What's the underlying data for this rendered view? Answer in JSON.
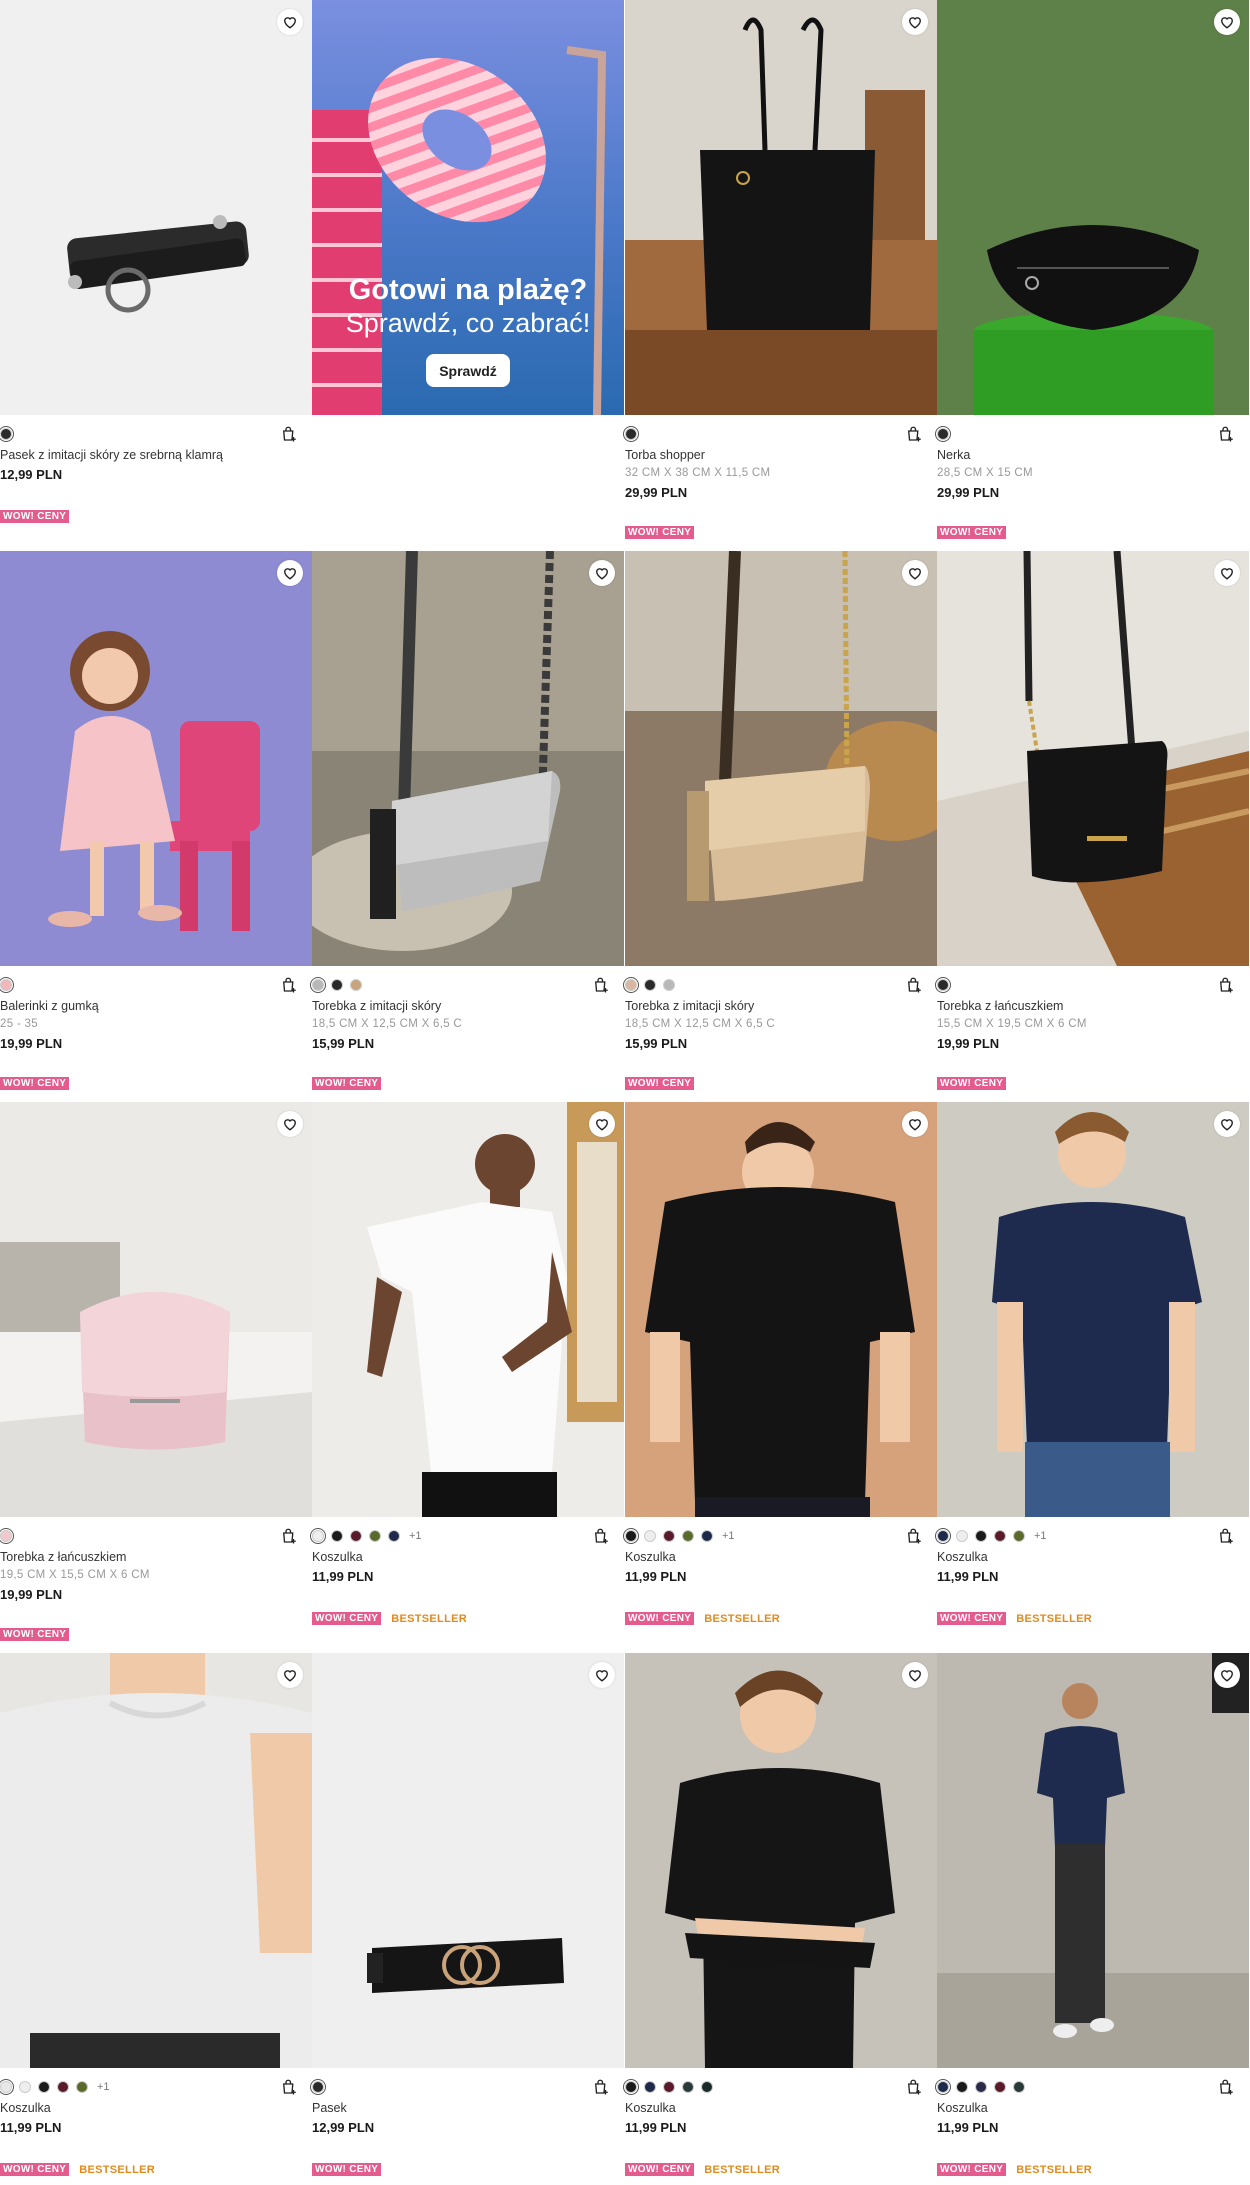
{
  "colors": {
    "wow": "#e45c8e",
    "bestseller": "#e28a1e"
  },
  "promo": {
    "title": "Gotowi na plażę?",
    "subtitle": "Sprawdź, co zabrać!",
    "button": "Sprawdź"
  },
  "products": [
    {
      "name": "Pasek z imitacji skóry ze srebrną klamrą",
      "dims": "",
      "price": "12,99 PLN",
      "badges": [
        "WOW! CENY"
      ],
      "swatches": [
        "#2a2a2a"
      ],
      "more": ""
    },
    {
      "name": "Torba shopper",
      "dims": "32 CM X 38 CM X 11,5 CM",
      "price": "29,99 PLN",
      "badges": [
        "WOW! CENY"
      ],
      "swatches": [
        "#2a2a2a"
      ],
      "more": ""
    },
    {
      "name": "Nerka",
      "dims": "28,5 CM X 15 CM",
      "price": "29,99 PLN",
      "badges": [
        "WOW! CENY"
      ],
      "swatches": [
        "#2a2a2a"
      ],
      "more": ""
    },
    {
      "name": "Balerinki z gumką",
      "dims": "25 - 35",
      "price": "19,99 PLN",
      "badges": [
        "WOW! CENY"
      ],
      "swatches": [
        "#f0b8b8"
      ],
      "more": ""
    },
    {
      "name": "Torebka z imitacji skóry",
      "dims": "18,5 CM X 12,5 CM X 6,5 C",
      "price": "15,99 PLN",
      "badges": [
        "WOW! CENY"
      ],
      "swatches": [
        "#b8b8b8",
        "#2a2a2a",
        "#c8a47c"
      ],
      "more": ""
    },
    {
      "name": "Torebka z imitacji skóry",
      "dims": "18,5 CM X 12,5 CM X 6,5 C",
      "price": "15,99 PLN",
      "badges": [
        "WOW! CENY"
      ],
      "swatches": [
        "#d8b8a0",
        "#2a2a2a",
        "#b8b8b8"
      ],
      "more": ""
    },
    {
      "name": "Torebka z łańcuszkiem",
      "dims": "15,5 CM X 19,5 CM X 6 CM",
      "price": "19,99 PLN",
      "badges": [
        "WOW! CENY"
      ],
      "swatches": [
        "#2a2a2a"
      ],
      "more": ""
    },
    {
      "name": "Torebka z łańcuszkiem",
      "dims": "19,5 CM X 15,5 CM X 6 CM",
      "price": "19,99 PLN",
      "badges": [
        "WOW! CENY"
      ],
      "swatches": [
        "#f2c8cc"
      ],
      "more": ""
    },
    {
      "name": "Koszulka",
      "dims": "",
      "price": "11,99 PLN",
      "badges": [
        "WOW! CENY",
        "BESTSELLER"
      ],
      "swatches": [
        "#eeeeee",
        "#1a1a1a",
        "#5a1a2a",
        "#5a6a2a",
        "#1e2a4a"
      ],
      "more": "+1"
    },
    {
      "name": "Koszulka",
      "dims": "",
      "price": "11,99 PLN",
      "badges": [
        "WOW! CENY",
        "BESTSELLER"
      ],
      "swatches": [
        "#1a1a1a",
        "#eeeeee",
        "#5a1a2a",
        "#5a6a2a",
        "#1e2a4a"
      ],
      "more": "+1"
    },
    {
      "name": "Koszulka",
      "dims": "",
      "price": "11,99 PLN",
      "badges": [
        "WOW! CENY",
        "BESTSELLER"
      ],
      "swatches": [
        "#1e2a4a",
        "#eeeeee",
        "#1a1a1a",
        "#5a1a2a",
        "#5a6a2a"
      ],
      "more": "+1"
    },
    {
      "name": "Koszulka",
      "dims": "",
      "price": "11,99 PLN",
      "badges": [
        "WOW! CENY",
        "BESTSELLER"
      ],
      "swatches": [
        "#e8e8e8",
        "#eeeeee",
        "#1a1a1a",
        "#5a1a2a",
        "#5a6a2a"
      ],
      "more": "+1"
    },
    {
      "name": "Pasek",
      "dims": "",
      "price": "12,99 PLN",
      "badges": [
        "WOW! CENY"
      ],
      "swatches": [
        "#2a2a2a"
      ],
      "more": ""
    },
    {
      "name": "Koszulka",
      "dims": "",
      "price": "11,99 PLN",
      "badges": [
        "WOW! CENY",
        "BESTSELLER"
      ],
      "swatches": [
        "#1a1a1a",
        "#1e2a4a",
        "#5a1a2a",
        "#2a3a3a",
        "#1a2a2a"
      ],
      "more": ""
    },
    {
      "name": "Koszulka",
      "dims": "",
      "price": "11,99 PLN",
      "badges": [
        "WOW! CENY",
        "BESTSELLER"
      ],
      "swatches": [
        "#1e2a4a",
        "#1a1a1a",
        "#2a2a4a",
        "#5a1a2a",
        "#2a3a3a"
      ],
      "more": ""
    }
  ]
}
